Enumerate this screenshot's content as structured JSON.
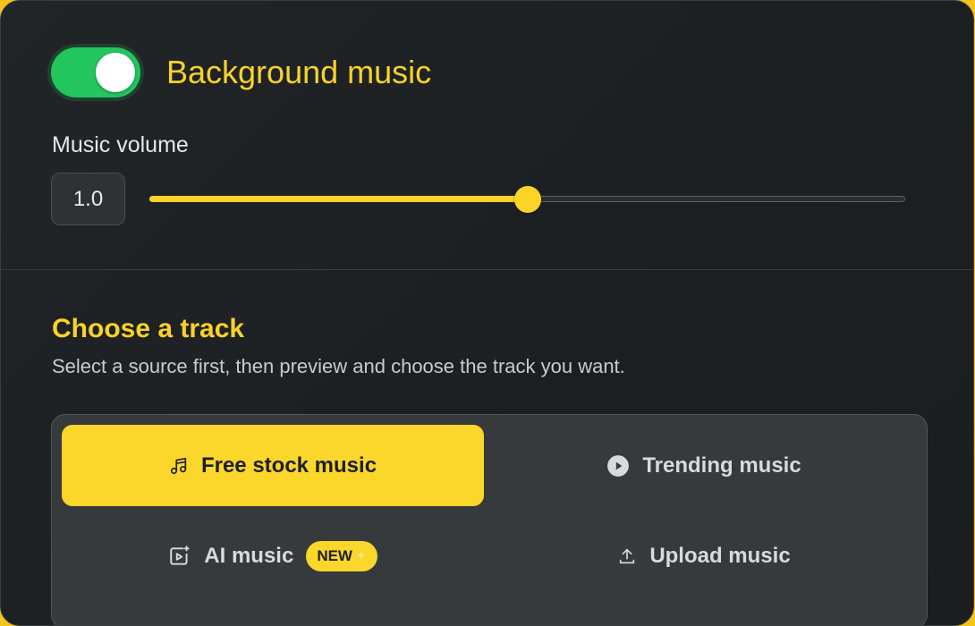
{
  "background_music": {
    "enabled": true,
    "title": "Background music"
  },
  "volume": {
    "label": "Music volume",
    "value": "1.0",
    "slider_fraction": 0.5
  },
  "choose_track": {
    "title": "Choose a track",
    "subtitle": "Select a source first, then preview and choose the track you want."
  },
  "sources": [
    {
      "label": "Free stock music",
      "icon": "music-note-icon",
      "active": true
    },
    {
      "label": "Trending music",
      "icon": "play-circle-icon",
      "active": false
    },
    {
      "label": "AI music",
      "icon": "ai-video-icon",
      "active": false,
      "badge": "NEW"
    },
    {
      "label": "Upload music",
      "icon": "upload-icon",
      "active": false
    }
  ],
  "colors": {
    "accent": "#fbd62b",
    "toggle_on": "#22c55e",
    "panel_bg": "#1e2123"
  }
}
